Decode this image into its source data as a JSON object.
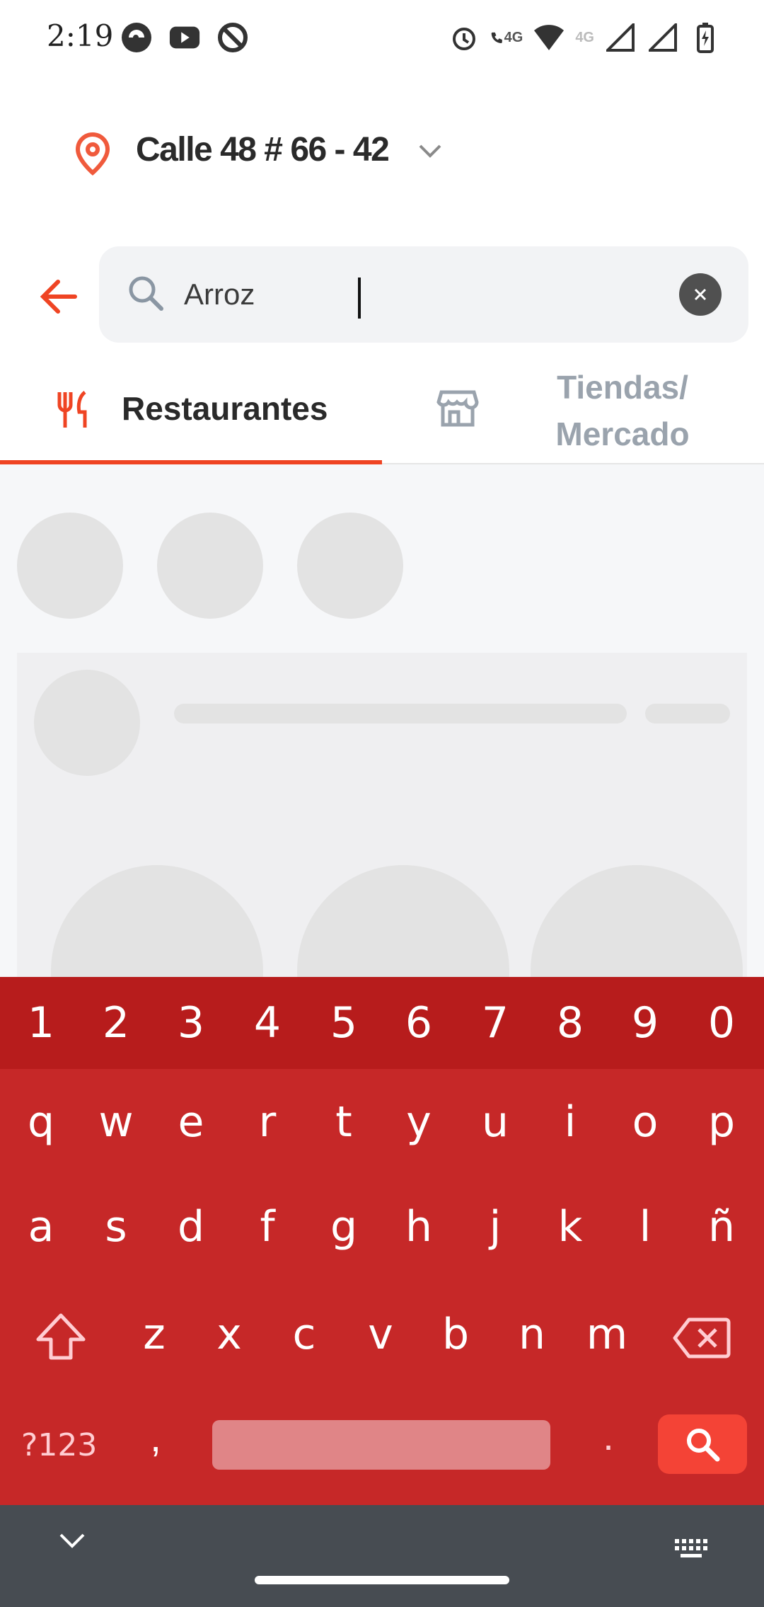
{
  "status_bar": {
    "time": "2:19",
    "left_icons": [
      "browser-icon",
      "youtube-icon",
      "data-saver-icon"
    ],
    "right_icons": [
      "alarm-icon",
      "volte-call-icon",
      "wifi-icon",
      "cell-signal-icon",
      "cell-signal-icon",
      "battery-charging-icon"
    ],
    "call_net_label": "4G",
    "signal_net_label": "4G"
  },
  "header": {
    "address": "Calle 48 # 66 - 42"
  },
  "search": {
    "value": "Arroz"
  },
  "tabs": [
    {
      "label": "Restaurantes",
      "active": true
    },
    {
      "label_line1": "Tiendas/",
      "label_line2": "Mercado",
      "active": false
    }
  ],
  "keyboard": {
    "numbers": [
      "1",
      "2",
      "3",
      "4",
      "5",
      "6",
      "7",
      "8",
      "9",
      "0"
    ],
    "row1": [
      "q",
      "w",
      "e",
      "r",
      "t",
      "y",
      "u",
      "i",
      "o",
      "p"
    ],
    "row2": [
      "a",
      "s",
      "d",
      "f",
      "g",
      "h",
      "j",
      "k",
      "l",
      "ñ"
    ],
    "row3": [
      "z",
      "x",
      "c",
      "v",
      "b",
      "n",
      "m"
    ],
    "symbols_label": "?123",
    "comma": ",",
    "period": "."
  },
  "colors": {
    "accent": "#ef4423",
    "keyboard_bg": "#c62828",
    "keyboard_numrow": "#b71c1c",
    "nav_bg": "#474c52"
  }
}
